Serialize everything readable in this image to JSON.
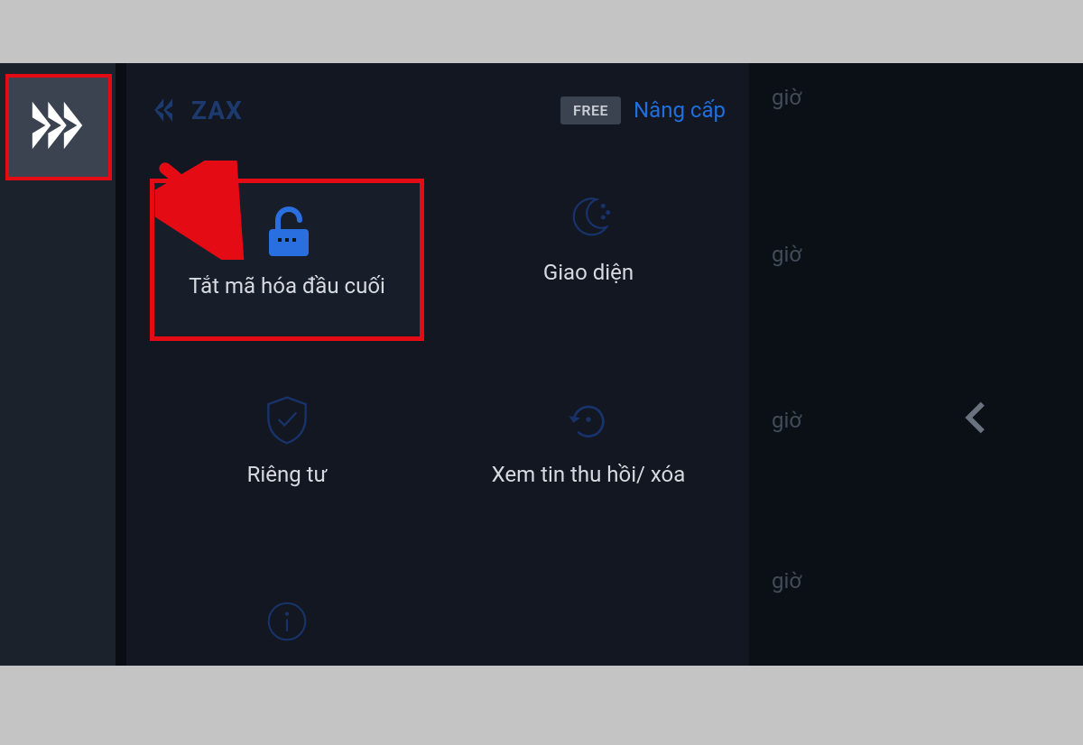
{
  "brand": {
    "name": "ZAX"
  },
  "header": {
    "badge": "FREE",
    "upgrade": "Nâng cấp"
  },
  "tiles": {
    "encryption": "Tắt mã hóa đầu cuối",
    "appearance": "Giao diện",
    "privacy": "Riêng tư",
    "recall": "Xem tin thu hồi/ xóa"
  },
  "background": {
    "time_label": "giờ"
  }
}
